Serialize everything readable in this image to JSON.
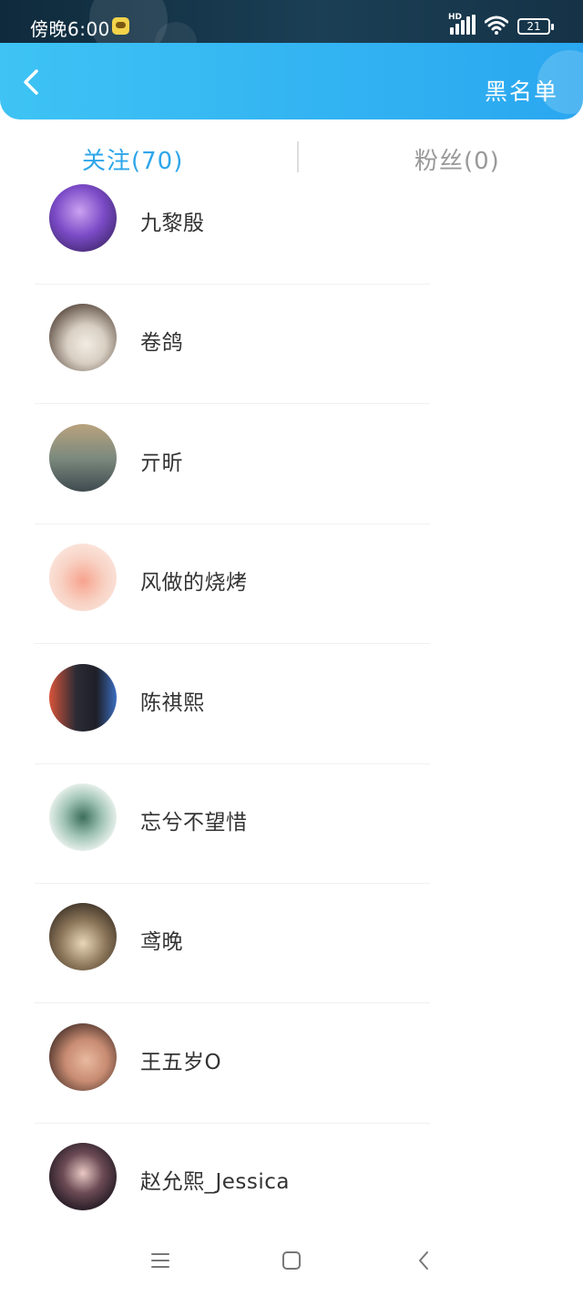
{
  "status_bar": {
    "time": "傍晚6:00",
    "network": "HD",
    "battery": "21"
  },
  "header": {
    "blacklist_label": "黑名单"
  },
  "tabs": [
    {
      "label": "关注(70)",
      "active": true
    },
    {
      "label": "粉丝(0)",
      "active": false
    }
  ],
  "users": [
    {
      "name": "九黎殷"
    },
    {
      "name": "卷鸽"
    },
    {
      "name": "亓昕"
    },
    {
      "name": "风做的烧烤"
    },
    {
      "name": "陈祺熙"
    },
    {
      "name": "忘兮不望惜"
    },
    {
      "name": "鸢晚"
    },
    {
      "name": "王五岁O"
    },
    {
      "name": "赵允熙_Jessica"
    }
  ],
  "colors": {
    "header_start": "#3ec3f4",
    "header_end": "#2aa7f0",
    "active_tab": "#2ea6ea",
    "inactive_tab": "#999999"
  }
}
